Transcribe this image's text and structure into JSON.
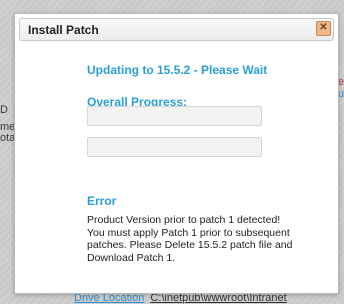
{
  "background": {
    "left_lines": [
      "D",
      "ment",
      "otain"
    ],
    "right_lines": [
      "e",
      "u"
    ],
    "bottom_label": "Drive Location",
    "bottom_value": "C:\\inetpub\\wwwroot\\Intranet"
  },
  "dialog": {
    "title": "Install Patch",
    "close_label": "✕",
    "status": "Updating to 15.5.2 - Please Wait",
    "progress_label": "Overall Progress:",
    "progress_overall": 0,
    "progress_step": 0,
    "error_title": "Error",
    "error_lines": [
      "Product Version prior to patch 1 detected!",
      "You must apply Patch 1 prior to subsequent",
      "patches. Please Delete 15.5.2 patch file and",
      "Download Patch 1."
    ]
  },
  "colors": {
    "accent": "#2a9fd6",
    "close_button": "#f0b889"
  }
}
